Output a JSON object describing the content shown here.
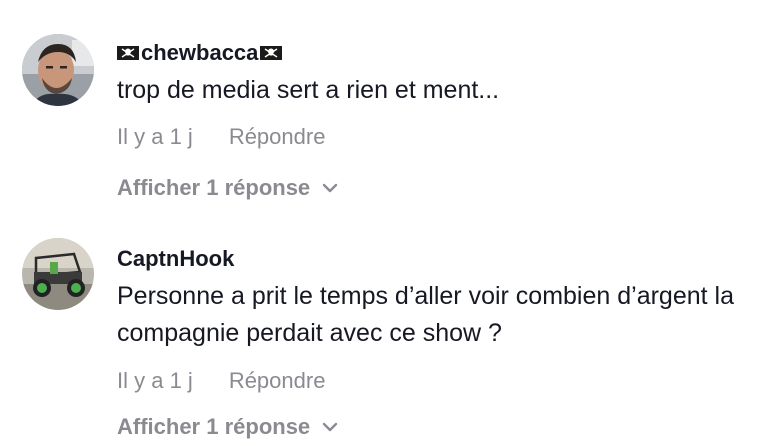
{
  "comments": [
    {
      "username": "chewbacca",
      "text": "trop de media sert a rien et ment...",
      "time": "Il y a 1 j",
      "reply_label": "Répondre",
      "show_replies_label": "Afficher 1 réponse",
      "avatar_icon": "profile-photo-man"
    },
    {
      "username": "CaptnHook",
      "text": "Personne a prit le temps d’aller voir combien d’argent la compagnie perdait avec ce show ?",
      "time": "Il y a 1 j",
      "reply_label": "Répondre",
      "show_replies_label": "Afficher 1 réponse",
      "avatar_icon": "profile-photo-buggy"
    }
  ],
  "colors": {
    "text_primary": "#161823",
    "text_secondary": "#8a8b91"
  }
}
